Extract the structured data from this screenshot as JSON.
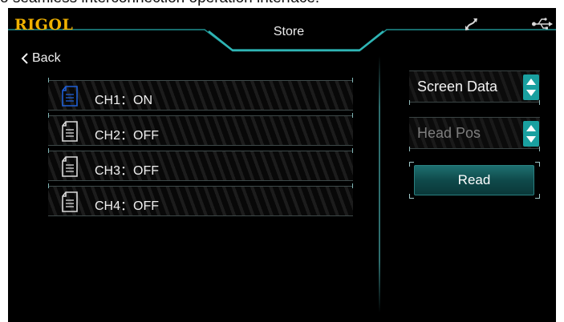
{
  "caption": {
    "text": "o seamless interconnection operation interface."
  },
  "header": {
    "brand": "RIGOL",
    "title": "Store"
  },
  "nav": {
    "back_label": "Back"
  },
  "channels": [
    {
      "label": "CH1：ON",
      "state": "on",
      "icon": "document-icon",
      "icon_color": "#1f5fd6"
    },
    {
      "label": "CH2：OFF",
      "state": "off",
      "icon": "document-icon",
      "icon_color": "#d9d9d9"
    },
    {
      "label": "CH3：OFF",
      "state": "off",
      "icon": "document-icon",
      "icon_color": "#d9d9d9"
    },
    {
      "label": "CH4：OFF",
      "state": "off",
      "icon": "document-icon",
      "icon_color": "#d9d9d9"
    }
  ],
  "storage": {
    "selected": "Screen Data"
  },
  "position": {
    "selected": "Head Pos"
  },
  "actions": {
    "read_label": "Read"
  },
  "colors": {
    "brand": "#f0b100",
    "accent": "#1aa0a0",
    "background": "#000000"
  }
}
